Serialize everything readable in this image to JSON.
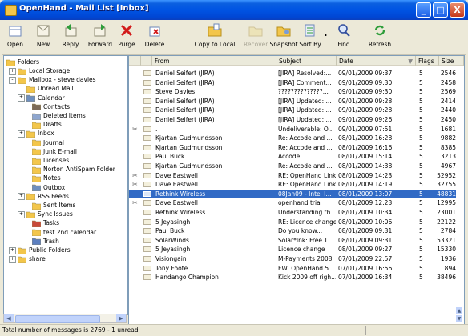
{
  "window": {
    "title": "OpenHand - Mail List [Inbox]",
    "controls": [
      "_",
      "□",
      "X"
    ]
  },
  "toolbar": [
    {
      "label": "Open",
      "icon": "open-icon",
      "disabled": false
    },
    {
      "label": "New",
      "icon": "new-icon",
      "disabled": false
    },
    {
      "label": "Reply",
      "icon": "reply-icon",
      "disabled": false
    },
    {
      "label": "Forward",
      "icon": "forward-icon",
      "disabled": false
    },
    {
      "label": "Purge",
      "icon": "purge-icon",
      "disabled": false
    },
    {
      "label": "Delete",
      "icon": "delete-icon",
      "disabled": false
    },
    {
      "label": "Copy to Local",
      "icon": "copy-to-local-icon",
      "disabled": false
    },
    {
      "label": "Recover",
      "icon": "recover-icon",
      "disabled": true
    },
    {
      "label": "Snapshot",
      "icon": "snapshot-icon",
      "disabled": false
    },
    {
      "label": "Sort By",
      "icon": "sort-by-icon",
      "disabled": false
    },
    {
      "label": "Find",
      "icon": "find-icon",
      "disabled": false
    },
    {
      "label": "Refresh",
      "icon": "refresh-icon",
      "disabled": false
    }
  ],
  "folders": {
    "header": "Folders",
    "items": [
      {
        "label": "Local Storage",
        "toggle": "+"
      },
      {
        "label": "Mailbox - steve davies",
        "toggle": "-"
      },
      {
        "label": "Unread Mail",
        "toggle": ""
      },
      {
        "label": "Calendar",
        "toggle": "+"
      },
      {
        "label": "Contacts",
        "toggle": ""
      },
      {
        "label": "Deleted Items",
        "toggle": ""
      },
      {
        "label": "Drafts",
        "toggle": ""
      },
      {
        "label": "Inbox",
        "toggle": "+"
      },
      {
        "label": "Journal",
        "toggle": ""
      },
      {
        "label": "Junk E-mail",
        "toggle": ""
      },
      {
        "label": "Licenses",
        "toggle": ""
      },
      {
        "label": "Norton AntiSpam Folder",
        "toggle": ""
      },
      {
        "label": "Notes",
        "toggle": ""
      },
      {
        "label": "Outbox",
        "toggle": ""
      },
      {
        "label": "RSS Feeds",
        "toggle": "+"
      },
      {
        "label": "Sent Items",
        "toggle": ""
      },
      {
        "label": "Sync Issues",
        "toggle": "+"
      },
      {
        "label": "Tasks",
        "toggle": ""
      },
      {
        "label": "test 2nd calendar",
        "toggle": ""
      },
      {
        "label": "Trash",
        "toggle": ""
      },
      {
        "label": "Public Folders",
        "toggle": "+"
      },
      {
        "label": "share",
        "toggle": "+"
      }
    ]
  },
  "columns": [
    "From",
    "Subject",
    "Date",
    "Flags",
    "Size"
  ],
  "messages": [
    {
      "attach": false,
      "from": "Daniel Seifert (JIRA)",
      "subject": "[JIRA] Resolved:...",
      "date": "09/01/2009 09:37",
      "flags": "5",
      "size": "2546",
      "selected": false
    },
    {
      "attach": false,
      "from": "Daniel Seifert (JIRA)",
      "subject": "[JIRA] Comment...",
      "date": "09/01/2009 09:30",
      "flags": "5",
      "size": "2458",
      "selected": false
    },
    {
      "attach": false,
      "from": "Steve Davies",
      "subject": "??????????????...",
      "date": "09/01/2009 09:30",
      "flags": "5",
      "size": "2569",
      "selected": false
    },
    {
      "attach": false,
      "from": "Daniel Seifert (JIRA)",
      "subject": "[JIRA] Updated: ...",
      "date": "09/01/2009 09:28",
      "flags": "5",
      "size": "2414",
      "selected": false
    },
    {
      "attach": false,
      "from": "Daniel Seifert (JIRA)",
      "subject": "[JIRA] Updated: ...",
      "date": "09/01/2009 09:28",
      "flags": "5",
      "size": "2440",
      "selected": false
    },
    {
      "attach": false,
      "from": "Daniel Seifert (JIRA)",
      "subject": "[JIRA] Updated: ...",
      "date": "09/01/2009 09:26",
      "flags": "5",
      "size": "2450",
      "selected": false
    },
    {
      "attach": true,
      "from": ".",
      "subject": "Undeliverable: O...",
      "date": "09/01/2009 07:51",
      "flags": "5",
      "size": "1681",
      "selected": false
    },
    {
      "attach": false,
      "from": "Kjartan Gudmundsson",
      "subject": "Re: Accode and ...",
      "date": "08/01/2009 16:28",
      "flags": "5",
      "size": "9882",
      "selected": false
    },
    {
      "attach": false,
      "from": "Kjartan Gudmundsson",
      "subject": "Re: Accode and ...",
      "date": "08/01/2009 16:16",
      "flags": "5",
      "size": "8385",
      "selected": false
    },
    {
      "attach": false,
      "from": "Paul Buck",
      "subject": "Accode...",
      "date": "08/01/2009 15:14",
      "flags": "5",
      "size": "3213",
      "selected": false
    },
    {
      "attach": false,
      "from": "Kjartan Gudmundsson",
      "subject": "Re: Accode and ...",
      "date": "08/01/2009 14:38",
      "flags": "5",
      "size": "4967",
      "selected": false
    },
    {
      "attach": true,
      "from": "Dave Eastwell",
      "subject": "RE: OpenHand Link",
      "date": "08/01/2009 14:23",
      "flags": "5",
      "size": "52952",
      "selected": false
    },
    {
      "attach": true,
      "from": "Dave Eastwell",
      "subject": "RE: OpenHand Link",
      "date": "08/01/2009 14:19",
      "flags": "5",
      "size": "32755",
      "selected": false
    },
    {
      "attach": false,
      "from": "Rethink Wireless",
      "subject": "08Jan09 - Intel I...",
      "date": "08/01/2009 13:07",
      "flags": "5",
      "size": "48831",
      "selected": true
    },
    {
      "attach": true,
      "from": "Dave Eastwell",
      "subject": "openhand trial",
      "date": "08/01/2009 12:23",
      "flags": "5",
      "size": "12995",
      "selected": false
    },
    {
      "attach": false,
      "from": "Rethink Wireless",
      "subject": "Understanding th...",
      "date": "08/01/2009 10:34",
      "flags": "5",
      "size": "23001",
      "selected": false
    },
    {
      "attach": false,
      "from": "5 Jeyasingh",
      "subject": "RE: Licence change",
      "date": "08/01/2009 10:06",
      "flags": "5",
      "size": "22122",
      "selected": false
    },
    {
      "attach": false,
      "from": "Paul Buck",
      "subject": "Do you know...",
      "date": "08/01/2009 09:31",
      "flags": "5",
      "size": "2784",
      "selected": false
    },
    {
      "attach": false,
      "from": "SolarWinds",
      "subject": "Solar*Ink: Free T...",
      "date": "08/01/2009 09:31",
      "flags": "5",
      "size": "53321",
      "selected": false
    },
    {
      "attach": false,
      "from": "5 Jeyasingh",
      "subject": "Licence change",
      "date": "08/01/2009 09:27",
      "flags": "5",
      "size": "15330",
      "selected": false
    },
    {
      "attach": false,
      "from": "Visiongain",
      "subject": "M-Payments 2008",
      "date": "07/01/2009 22:57",
      "flags": "5",
      "size": "1936",
      "selected": false
    },
    {
      "attach": false,
      "from": "Tony Foote",
      "subject": "FW: OpenHand 5...",
      "date": "07/01/2009 16:56",
      "flags": "5",
      "size": "894",
      "selected": false
    },
    {
      "attach": false,
      "from": "Handango Champion",
      "subject": "Kick 2009 off righ...",
      "date": "07/01/2009 16:34",
      "flags": "5",
      "size": "38496",
      "selected": false
    }
  ],
  "status": {
    "text": "Total number of messages is 2769 - 1 unread"
  },
  "colors": {
    "titlebar": "#0054e3",
    "selection": "#316ac5",
    "folder": "#f3c64b"
  }
}
